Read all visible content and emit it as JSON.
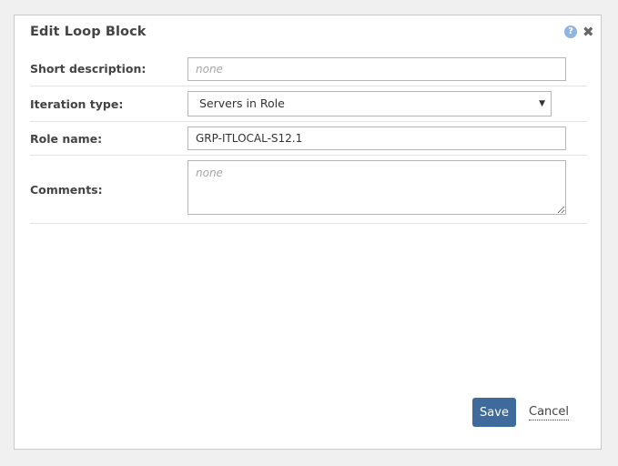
{
  "dialog": {
    "title": "Edit Loop Block",
    "help_icon": "help-icon",
    "help_glyph": "?",
    "close_icon": "close-icon",
    "close_glyph": "✖"
  },
  "form": {
    "short_description": {
      "label": "Short description:",
      "value": "",
      "placeholder": "none"
    },
    "iteration_type": {
      "label": "Iteration type:",
      "selected": "Servers in Role",
      "arrow": "▼"
    },
    "role_name": {
      "label": "Role name:",
      "value": "GRP-ITLOCAL-S12.1",
      "placeholder": ""
    },
    "comments": {
      "label": "Comments:",
      "value": "",
      "placeholder": "none"
    }
  },
  "actions": {
    "save_label": "Save",
    "cancel_label": "Cancel"
  },
  "colors": {
    "primary_button": "#3f6b9c",
    "help_icon": "#8fb4e0"
  }
}
